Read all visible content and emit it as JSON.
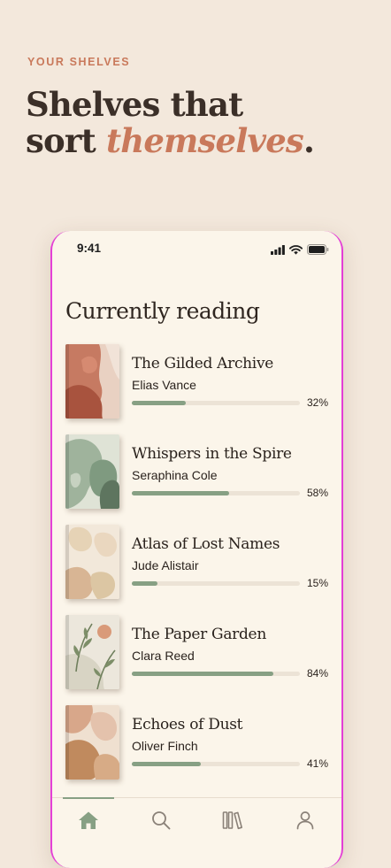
{
  "header": {
    "eyebrow": "YOUR SHELVES",
    "headline_line1": "Shelves that",
    "headline_line2_plain": "sort ",
    "headline_line2_accent": "themselves",
    "headline_line2_end": "."
  },
  "status_bar": {
    "time": "9:41",
    "icons": [
      "cellular-signal-icon",
      "wifi-icon",
      "battery-icon"
    ]
  },
  "section_title": "Currently reading",
  "books": [
    {
      "title": "The Gilded Archive",
      "author": "Elias Vance",
      "progress": 0.32,
      "progress_label": "32%"
    },
    {
      "title": "Whispers in the Spire",
      "author": "Seraphina Cole",
      "progress": 0.58,
      "progress_label": "58%"
    },
    {
      "title": "Atlas of Lost Names",
      "author": "Jude Alistair",
      "progress": 0.15,
      "progress_label": "15%"
    },
    {
      "title": "The Paper Garden",
      "author": "Clara Reed",
      "progress": 0.84,
      "progress_label": "84%"
    },
    {
      "title": "Echoes of Dust",
      "author": "Oliver Finch",
      "progress": 0.41,
      "progress_label": "41%"
    }
  ],
  "tab_bar": {
    "active": "home",
    "tabs": [
      "home-icon",
      "search-icon",
      "library-icon",
      "profile-icon"
    ]
  },
  "colors": {
    "background": "#f3e8dc",
    "accent": "#c9795b",
    "progress_fill": "#87a084",
    "progress_track": "#ece3d6",
    "phone_surface": "#fbf5ea"
  }
}
